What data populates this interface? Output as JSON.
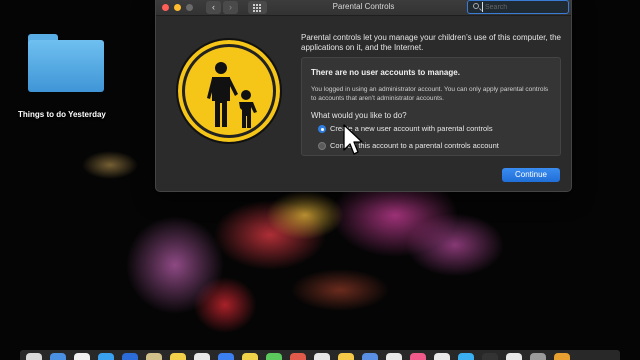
{
  "desktop": {
    "folder_label": "Things to do Yesterday"
  },
  "window": {
    "title": "Parental Controls",
    "search_placeholder": "Search",
    "intro_text": "Parental controls let you manage your children’s use of this computer, the applications on it, and the Internet.",
    "panel": {
      "heading": "There are no user accounts to manage.",
      "body": "You logged in using an administrator account. You can only apply parental controls to accounts that aren’t administrator accounts.",
      "question": "What would you like to do?",
      "options": [
        {
          "label": "Create a new user account with parental controls",
          "selected": true
        },
        {
          "label": "Convert this account to a parental controls account",
          "selected": false
        }
      ]
    },
    "continue_label": "Continue"
  },
  "icons": {
    "app_icon": "parental-controls-icon",
    "nav_back": "chevron-left-icon",
    "nav_forward": "chevron-right-icon",
    "grid": "grid-icon",
    "search": "search-icon"
  },
  "colors": {
    "accent": "#2f7de1",
    "icon_yellow": "#f5c518",
    "window_bg": "#2b2b2b"
  },
  "dock": {
    "icons": [
      "#d9d9d9",
      "#4a90e2",
      "#f0f0f0",
      "#3aa0f0",
      "#2b6cd8",
      "#d2c08a",
      "#f2d04a",
      "#e8e8e8",
      "#3c7ff0",
      "#f0d24a",
      "#5bc95b",
      "#e25b4a",
      "#e6e6e6",
      "#f7c948",
      "#5a8fe6",
      "#e8e8e8",
      "#f05a8a",
      "#e8e8e8",
      "#3ab0f0",
      "#333333",
      "#e8e8e8",
      "#9a9a9a",
      "#e8a030"
    ]
  }
}
